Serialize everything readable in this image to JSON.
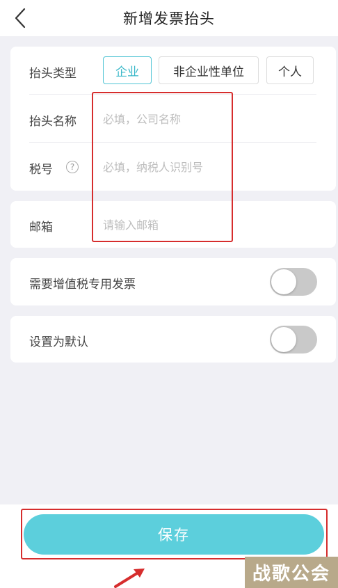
{
  "header": {
    "title": "新增发票抬头"
  },
  "invoice_card": {
    "type_label": "抬头类型",
    "types": [
      "企业",
      "非企业性单位",
      "个人"
    ],
    "name_label": "抬头名称",
    "name_placeholder": "必填，公司名称",
    "tax_label": "税号",
    "tax_help": "?",
    "tax_placeholder": "必填，纳税人识别号"
  },
  "email_card": {
    "label": "邮箱",
    "placeholder": "请输入邮箱"
  },
  "vat_card": {
    "label": "需要增值税专用发票",
    "enabled": false
  },
  "default_card": {
    "label": "设置为默认",
    "enabled": false
  },
  "footer": {
    "save_label": "保存"
  },
  "watermark": {
    "text": "战歌公会"
  },
  "colors": {
    "accent": "#5ccfdc",
    "highlight": "#d62d2d",
    "toggle_off": "#c9c9c9"
  }
}
